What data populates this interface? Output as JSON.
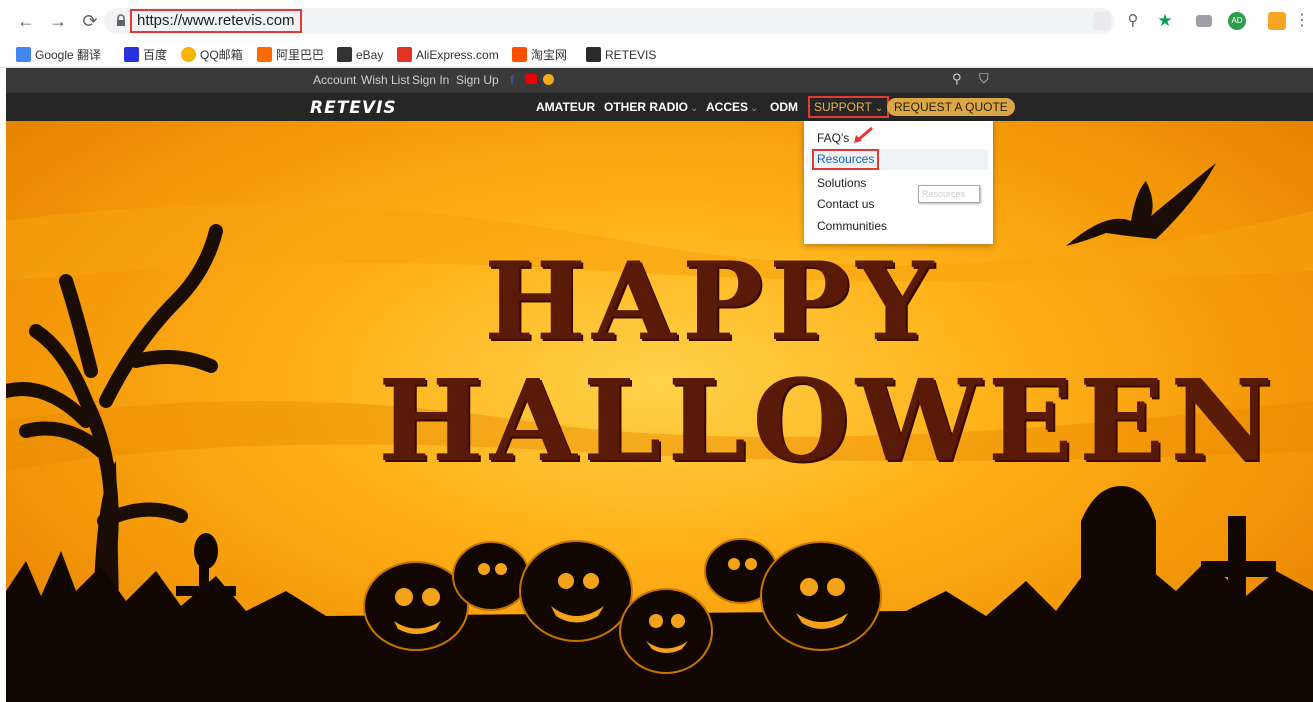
{
  "browser": {
    "url": "https://www.retevis.com",
    "bookmarks": [
      {
        "label": "Google 翻译",
        "icon": "google-translate-icon",
        "color": "#4285f4"
      },
      {
        "label": "百度",
        "icon": "baidu-icon",
        "color": "#2932e1"
      },
      {
        "label": "QQ邮箱",
        "icon": "qq-mail-icon",
        "color": "#f4b400"
      },
      {
        "label": "阿里巴巴",
        "icon": "alibaba-icon",
        "color": "#ff6a00"
      },
      {
        "label": "eBay",
        "icon": "ebay-icon",
        "color": "#333333"
      },
      {
        "label": "AliExpress.com",
        "icon": "aliexpress-icon",
        "color": "#e43225"
      },
      {
        "label": "淘宝网",
        "icon": "taobao-icon",
        "color": "#ff5000"
      },
      {
        "label": "RETEVIS",
        "icon": "retevis-icon",
        "color": "#2b2b2b"
      }
    ],
    "extension_badge": "AD"
  },
  "site": {
    "topbar": {
      "links": [
        "Account",
        "Wish List",
        "Sign In",
        "Sign Up"
      ]
    },
    "logo": "RETEVIS",
    "nav": {
      "amateur": "AMATEUR",
      "other_radio": "OTHER RADIO",
      "acces": "ACCES",
      "odm": "ODM",
      "support": "SUPPORT",
      "quote": "REQUEST A QUOTE"
    },
    "dropdown": {
      "items": [
        "FAQ's",
        "Resources",
        "Solutions",
        "Contact us",
        "Communities"
      ],
      "tooltip": "Resources"
    },
    "hero": {
      "line1": "HAPPY",
      "line2": "HALLOWEEN"
    }
  },
  "colors": {
    "highlight": "#e53935",
    "accent": "#d9a746"
  }
}
